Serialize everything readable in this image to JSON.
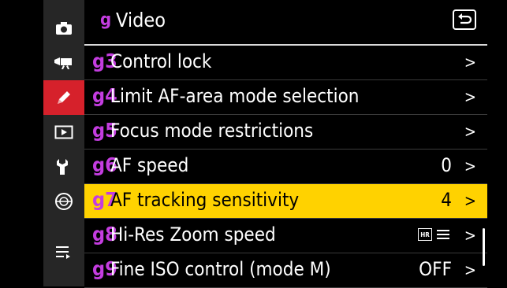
{
  "header": {
    "letter": "g",
    "title": "Video"
  },
  "sidebar": [
    {
      "icon": "camera-icon",
      "active": false
    },
    {
      "icon": "movie-camera-icon",
      "active": false
    },
    {
      "icon": "pencil-icon",
      "active": true
    },
    {
      "icon": "playback-icon",
      "active": false
    },
    {
      "icon": "wrench-icon",
      "active": false
    },
    {
      "icon": "network-icon",
      "active": false
    },
    {
      "icon": "my-menu-icon",
      "active": false
    }
  ],
  "rows": [
    {
      "code": "g3",
      "label": "Control lock",
      "value": ""
    },
    {
      "code": "g4",
      "label": "Limit AF-area mode selection",
      "value": ""
    },
    {
      "code": "g5",
      "label": "Focus mode restrictions",
      "value": ""
    },
    {
      "code": "g6",
      "label": "AF speed",
      "value": "0"
    },
    {
      "code": "g7",
      "label": "AF tracking sensitivity",
      "value": "4",
      "selected": true
    },
    {
      "code": "g8",
      "label": "Hi-Res Zoom speed",
      "value": ""
    },
    {
      "code": "g9",
      "label": "Fine ISO control (mode M)",
      "value": "OFF"
    }
  ],
  "chevron": ">",
  "hr_badge": "HR",
  "colors": {
    "selected": "#ffd200",
    "active_tab": "#d6212b",
    "code": "#c43de0"
  }
}
